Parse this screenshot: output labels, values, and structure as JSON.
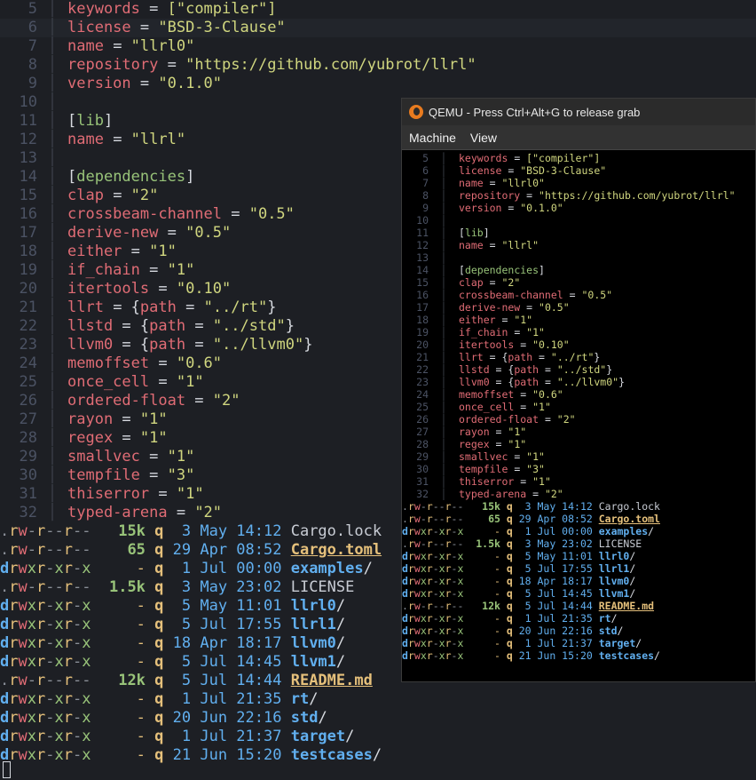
{
  "editor": {
    "lines": [
      {
        "n": "5",
        "key": "keywords",
        "val": "[\"compiler\"]"
      },
      {
        "n": "6",
        "key": "license",
        "val": "\"BSD-3-Clause\""
      },
      {
        "n": "7",
        "key": "name",
        "val": "\"llrl0\""
      },
      {
        "n": "8",
        "key": "repository",
        "val": "\"https://github.com/yubrot/llrl\""
      },
      {
        "n": "9",
        "key": "version",
        "val": "\"0.1.0\""
      },
      {
        "n": "10",
        "key": "",
        "val": ""
      },
      {
        "n": "11",
        "sec": "[lib]"
      },
      {
        "n": "12",
        "key": "name",
        "val": "\"llrl\""
      },
      {
        "n": "13",
        "key": "",
        "val": ""
      },
      {
        "n": "14",
        "sec": "[dependencies]"
      },
      {
        "n": "15",
        "key": "clap",
        "val": "\"2\""
      },
      {
        "n": "16",
        "key": "crossbeam-channel",
        "val": "\"0.5\""
      },
      {
        "n": "17",
        "key": "derive-new",
        "val": "\"0.5\""
      },
      {
        "n": "18",
        "key": "either",
        "val": "\"1\""
      },
      {
        "n": "19",
        "key": "if_chain",
        "val": "\"1\""
      },
      {
        "n": "20",
        "key": "itertools",
        "val": "\"0.10\""
      },
      {
        "n": "21",
        "key": "llrt",
        "path": "\"../rt\""
      },
      {
        "n": "22",
        "key": "llstd",
        "path": "\"../std\""
      },
      {
        "n": "23",
        "key": "llvm0",
        "path": "\"../llvm0\""
      },
      {
        "n": "24",
        "key": "memoffset",
        "val": "\"0.6\""
      },
      {
        "n": "25",
        "key": "once_cell",
        "val": "\"1\""
      },
      {
        "n": "26",
        "key": "ordered-float",
        "val": "\"2\""
      },
      {
        "n": "27",
        "key": "rayon",
        "val": "\"1\""
      },
      {
        "n": "28",
        "key": "regex",
        "val": "\"1\""
      },
      {
        "n": "29",
        "key": "smallvec",
        "val": "\"1\""
      },
      {
        "n": "30",
        "key": "tempfile",
        "val": "\"3\""
      },
      {
        "n": "31",
        "key": "thiserror",
        "val": "\"1\""
      },
      {
        "n": "32",
        "key": "typed-arena",
        "val": "\"2\""
      }
    ]
  },
  "listing": [
    {
      "perm": ".rw-r--r--",
      "size": "15k",
      "user": "q",
      "date": " 3 May 14:12",
      "name": "Cargo.lock",
      "kind": "file"
    },
    {
      "perm": ".rw-r--r--",
      "size": "65",
      "user": "q",
      "date": "29 Apr 08:52",
      "name": "Cargo.toml",
      "kind": "toml"
    },
    {
      "perm": "drwxr-xr-x",
      "size": "-",
      "user": "q",
      "date": " 1 Jul 00:00",
      "name": "examples",
      "kind": "dir"
    },
    {
      "perm": ".rw-r--r--",
      "size": "1.5k",
      "user": "q",
      "date": " 3 May 23:02",
      "name": "LICENSE",
      "kind": "file"
    },
    {
      "perm": "drwxr-xr-x",
      "size": "-",
      "user": "q",
      "date": " 5 May 11:01",
      "name": "llrl0",
      "kind": "dir"
    },
    {
      "perm": "drwxr-xr-x",
      "size": "-",
      "user": "q",
      "date": " 5 Jul 17:55",
      "name": "llrl1",
      "kind": "dir"
    },
    {
      "perm": "drwxr-xr-x",
      "size": "-",
      "user": "q",
      "date": "18 Apr 18:17",
      "name": "llvm0",
      "kind": "dir"
    },
    {
      "perm": "drwxr-xr-x",
      "size": "-",
      "user": "q",
      "date": " 5 Jul 14:45",
      "name": "llvm1",
      "kind": "dir"
    },
    {
      "perm": ".rw-r--r--",
      "size": "12k",
      "user": "q",
      "date": " 5 Jul 14:44",
      "name": "README.md",
      "kind": "toml"
    },
    {
      "perm": "drwxr-xr-x",
      "size": "-",
      "user": "q",
      "date": " 1 Jul 21:35",
      "name": "rt",
      "kind": "dir"
    },
    {
      "perm": "drwxr-xr-x",
      "size": "-",
      "user": "q",
      "date": "20 Jun 22:16",
      "name": "std",
      "kind": "dir"
    },
    {
      "perm": "drwxr-xr-x",
      "size": "-",
      "user": "q",
      "date": " 1 Jul 21:37",
      "name": "target",
      "kind": "dir"
    },
    {
      "perm": "drwxr-xr-x",
      "size": "-",
      "user": "q",
      "date": "21 Jun 15:20",
      "name": "testcases",
      "kind": "dir"
    }
  ],
  "qemu": {
    "title": "QEMU - Press Ctrl+Alt+G to release grab",
    "menu": [
      "Machine",
      "View"
    ]
  },
  "colors": {
    "background": "#1d1f24",
    "key": "#e06c75",
    "string": "#d0d67f",
    "directory": "#61afef"
  }
}
